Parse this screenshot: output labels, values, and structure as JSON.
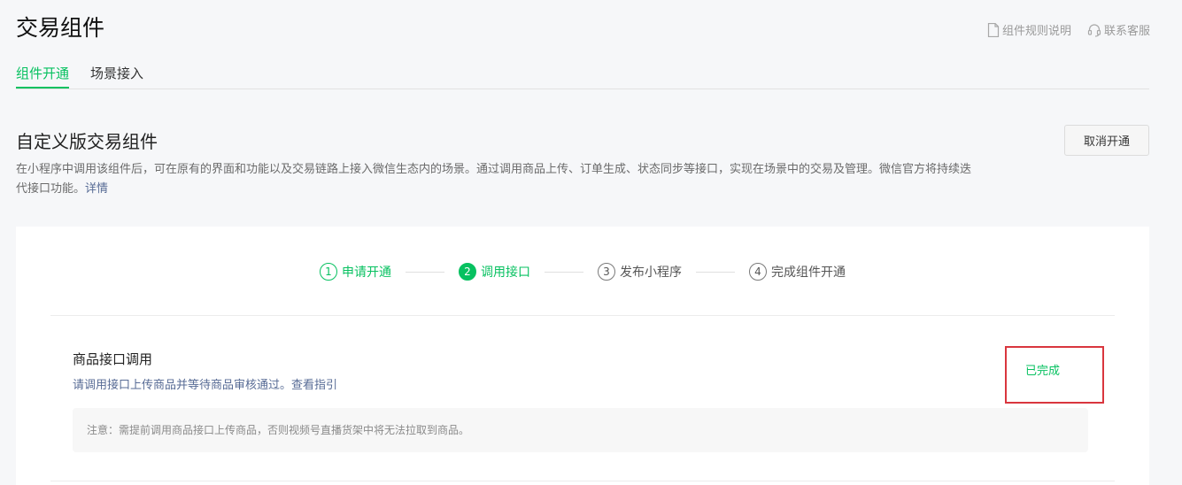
{
  "header": {
    "title": "交易组件",
    "links": [
      {
        "label": "组件规则说明",
        "icon": "document-icon"
      },
      {
        "label": "联系客服",
        "icon": "headset-icon"
      }
    ]
  },
  "tabs": [
    {
      "label": "组件开通",
      "active": true
    },
    {
      "label": "场景接入",
      "active": false
    }
  ],
  "section": {
    "title": "自定义版交易组件",
    "description": "在小程序中调用该组件后，可在原有的界面和功能以及交易链路上接入微信生态内的场景。通过调用商品上传、订单生成、状态同步等接口，实现在场景中的交易及管理。微信官方将持续迭代接口功能。",
    "detail_link": "详情",
    "cancel_button": "取消开通"
  },
  "steps": [
    {
      "num": "1",
      "label": "申请开通",
      "state": "done"
    },
    {
      "num": "2",
      "label": "调用接口",
      "state": "current"
    },
    {
      "num": "3",
      "label": "发布小程序",
      "state": "pending"
    },
    {
      "num": "4",
      "label": "完成组件开通",
      "state": "pending"
    }
  ],
  "task": {
    "title": "商品接口调用",
    "desc_prefix": "请调用接口上传商品并等待商品审核通过。",
    "guide_link": "查看指引",
    "status": "已完成",
    "notice": "注意：需提前调用商品接口上传商品，否则视频号直播货架中将无法拉取到商品。"
  },
  "colors": {
    "accent": "#07c160",
    "link": "#576b95",
    "highlight": "#d9363e"
  }
}
